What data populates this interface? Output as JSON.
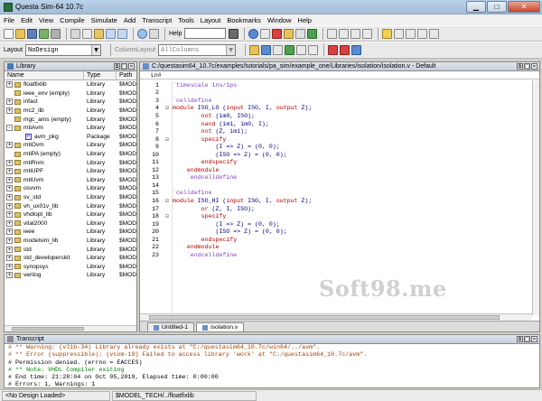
{
  "window": {
    "title": "Questa Sim-64 10.7c"
  },
  "menu": [
    "File",
    "Edit",
    "View",
    "Compile",
    "Simulate",
    "Add",
    "Transcript",
    "Tools",
    "Layout",
    "Bookmarks",
    "Window",
    "Help"
  ],
  "toolbar": {
    "help_label": "Help",
    "layout_label": "Layout",
    "layout_value": "NoDesign",
    "column_layout_label": "ColumnLayout",
    "column_layout_value": "AllColumns"
  },
  "library": {
    "title": "Library",
    "columns": [
      "Name",
      "Type",
      "Path"
    ],
    "items": [
      {
        "name": "floatfixlib",
        "type": "Library",
        "path": "$MODE",
        "expand": "+",
        "depth": 0,
        "kind": "lib"
      },
      {
        "name": "ieee_env  (empty)",
        "type": "Library",
        "path": "$MODE",
        "expand": "",
        "depth": 0,
        "kind": "lib"
      },
      {
        "name": "infact",
        "type": "Library",
        "path": "$MODE",
        "expand": "+",
        "depth": 0,
        "kind": "lib"
      },
      {
        "name": "mc2_lib",
        "type": "Library",
        "path": "$MODE",
        "expand": "+",
        "depth": 0,
        "kind": "lib"
      },
      {
        "name": "mgc_ams  (empty)",
        "type": "Library",
        "path": "$MODE",
        "expand": "",
        "depth": 0,
        "kind": "lib"
      },
      {
        "name": "mtiAvm",
        "type": "Library",
        "path": "$MODE",
        "expand": "-",
        "depth": 0,
        "kind": "lib"
      },
      {
        "name": "avm_pkg",
        "type": "Package",
        "path": "$MODE",
        "expand": "",
        "depth": 1,
        "kind": "pkg"
      },
      {
        "name": "mtiOvm",
        "type": "Library",
        "path": "$MODE",
        "expand": "+",
        "depth": 0,
        "kind": "lib"
      },
      {
        "name": "mtiPA  (empty)",
        "type": "Library",
        "path": "$MODE",
        "expand": "",
        "depth": 0,
        "kind": "lib"
      },
      {
        "name": "mtiRnm",
        "type": "Library",
        "path": "$MODE",
        "expand": "+",
        "depth": 0,
        "kind": "lib"
      },
      {
        "name": "mtiUPF",
        "type": "Library",
        "path": "$MODE",
        "expand": "+",
        "depth": 0,
        "kind": "lib"
      },
      {
        "name": "mtiUvm",
        "type": "Library",
        "path": "$MODE",
        "expand": "+",
        "depth": 0,
        "kind": "lib"
      },
      {
        "name": "osvvm",
        "type": "Library",
        "path": "$MODE",
        "expand": "+",
        "depth": 0,
        "kind": "lib"
      },
      {
        "name": "sv_std",
        "type": "Library",
        "path": "$MODE",
        "expand": "+",
        "depth": 0,
        "kind": "lib"
      },
      {
        "name": "vh_ux01v_lib",
        "type": "Library",
        "path": "$MODE",
        "expand": "+",
        "depth": 0,
        "kind": "lib"
      },
      {
        "name": "vhdlopt_lib",
        "type": "Library",
        "path": "$MODE",
        "expand": "+",
        "depth": 0,
        "kind": "lib"
      },
      {
        "name": "vital2000",
        "type": "Library",
        "path": "$MODE",
        "expand": "+",
        "depth": 0,
        "kind": "lib"
      },
      {
        "name": "ieee",
        "type": "Library",
        "path": "$MODE",
        "expand": "+",
        "depth": 0,
        "kind": "lib"
      },
      {
        "name": "modelsim_lib",
        "type": "Library",
        "path": "$MODE",
        "expand": "+",
        "depth": 0,
        "kind": "lib"
      },
      {
        "name": "std",
        "type": "Library",
        "path": "$MODE",
        "expand": "+",
        "depth": 0,
        "kind": "lib"
      },
      {
        "name": "std_developerskit",
        "type": "Library",
        "path": "$MODE",
        "expand": "+",
        "depth": 0,
        "kind": "lib"
      },
      {
        "name": "synopsys",
        "type": "Library",
        "path": "$MODE",
        "expand": "+",
        "depth": 0,
        "kind": "lib"
      },
      {
        "name": "verilog",
        "type": "Library",
        "path": "$MODE",
        "expand": "+",
        "depth": 0,
        "kind": "lib"
      }
    ]
  },
  "editor": {
    "title": "C:/questasim64_10.7c/examples/tutorials/pa_sim/example_one/Libraries/isolation/isolation.v - Default",
    "ln_header": "Ln#",
    "lines": [
      {
        "n": "1",
        "fold": "",
        "parts": [
          [
            "mac",
            "`timescale 1ns/1ps"
          ]
        ]
      },
      {
        "n": "2",
        "fold": "",
        "parts": []
      },
      {
        "n": "3",
        "fold": "",
        "parts": [
          [
            "mac",
            "`celldefine"
          ]
        ]
      },
      {
        "n": "4",
        "fold": "⊟",
        "parts": [
          [
            "k",
            "module "
          ],
          [
            "plain",
            "ISO_LO ("
          ],
          [
            "k",
            "input "
          ],
          [
            "plain",
            "ISO, I, "
          ],
          [
            "k",
            "output "
          ],
          [
            "plain",
            "Z);"
          ]
        ]
      },
      {
        "n": "5",
        "fold": "",
        "parts": [
          [
            "plain",
            "        "
          ],
          [
            "k",
            "not "
          ],
          [
            "plain",
            "(im0, ISO);"
          ]
        ]
      },
      {
        "n": "6",
        "fold": "",
        "parts": [
          [
            "plain",
            "        "
          ],
          [
            "k",
            "nand "
          ],
          [
            "plain",
            "(im1, im0, I);"
          ]
        ]
      },
      {
        "n": "7",
        "fold": "",
        "parts": [
          [
            "plain",
            "        "
          ],
          [
            "k",
            "not "
          ],
          [
            "plain",
            "(Z, im1);"
          ]
        ]
      },
      {
        "n": "8",
        "fold": "⊟",
        "parts": [
          [
            "plain",
            "        "
          ],
          [
            "k",
            "specify"
          ]
        ]
      },
      {
        "n": "9",
        "fold": "",
        "parts": [
          [
            "plain",
            "            (I => Z) = (0, 0);"
          ]
        ]
      },
      {
        "n": "10",
        "fold": "",
        "parts": [
          [
            "plain",
            "            (ISO => Z) = (0, 0);"
          ]
        ]
      },
      {
        "n": "11",
        "fold": "",
        "parts": [
          [
            "plain",
            "        "
          ],
          [
            "k",
            "endspecify"
          ]
        ]
      },
      {
        "n": "12",
        "fold": "",
        "parts": [
          [
            "plain",
            "    "
          ],
          [
            "k",
            "endmodule"
          ]
        ]
      },
      {
        "n": "13",
        "fold": "",
        "parts": [
          [
            "mac",
            "    `endcelldefine"
          ]
        ]
      },
      {
        "n": "14",
        "fold": "",
        "parts": []
      },
      {
        "n": "15",
        "fold": "",
        "parts": [
          [
            "mac",
            "`celldefine"
          ]
        ]
      },
      {
        "n": "16",
        "fold": "⊟",
        "parts": [
          [
            "k",
            "module "
          ],
          [
            "plain",
            "ISO_HI ("
          ],
          [
            "k",
            "input "
          ],
          [
            "plain",
            "ISO, I, "
          ],
          [
            "k",
            "output "
          ],
          [
            "plain",
            "Z);"
          ]
        ]
      },
      {
        "n": "17",
        "fold": "",
        "parts": [
          [
            "plain",
            "        "
          ],
          [
            "k",
            "or "
          ],
          [
            "plain",
            "(Z, I, ISO);"
          ]
        ]
      },
      {
        "n": "18",
        "fold": "⊟",
        "parts": [
          [
            "plain",
            "        "
          ],
          [
            "k",
            "specify"
          ]
        ]
      },
      {
        "n": "19",
        "fold": "",
        "parts": [
          [
            "plain",
            "            (I => Z) = (0, 0);"
          ]
        ]
      },
      {
        "n": "20",
        "fold": "",
        "parts": [
          [
            "plain",
            "            (ISO => Z) = (0, 0);"
          ]
        ]
      },
      {
        "n": "21",
        "fold": "",
        "parts": [
          [
            "plain",
            "        "
          ],
          [
            "k",
            "endspecify"
          ]
        ]
      },
      {
        "n": "22",
        "fold": "",
        "parts": [
          [
            "plain",
            "    "
          ],
          [
            "k",
            "endmodule"
          ]
        ]
      },
      {
        "n": "23",
        "fold": "",
        "parts": [
          [
            "mac",
            "    `endcelldefine"
          ]
        ]
      }
    ],
    "tabs": [
      "Untitled-1",
      "isolation.v"
    ],
    "active_tab": 1
  },
  "watermark": "Soft98.me",
  "transcript": {
    "title": "Transcript",
    "lines": [
      {
        "cls": "warn",
        "text": "# ** Warning: (vlib-34) Library already exists at \"C:/questasim64_10.7c/win64/../avm\"."
      },
      {
        "cls": "warn",
        "text": "# ** Error (suppressible): (vcom-19) Failed to access library 'work' at \"C:/questasim64_10.7c/avm\"."
      },
      {
        "cls": "err",
        "text": "# Permission denied. (errno = EACCES)"
      },
      {
        "cls": "note",
        "text": "# ** Note: VHDL Compiler exiting"
      },
      {
        "cls": "err",
        "text": "# End time: 21:28:04 on Oct 05,2019, Elapsed time: 0:00:00"
      },
      {
        "cls": "cmd",
        "text": "# Errors: 1, Warnings: 1"
      }
    ]
  },
  "status": {
    "design": "<No Design Loaded>",
    "path": "$MODEL_TECH/../floatfixlib"
  }
}
